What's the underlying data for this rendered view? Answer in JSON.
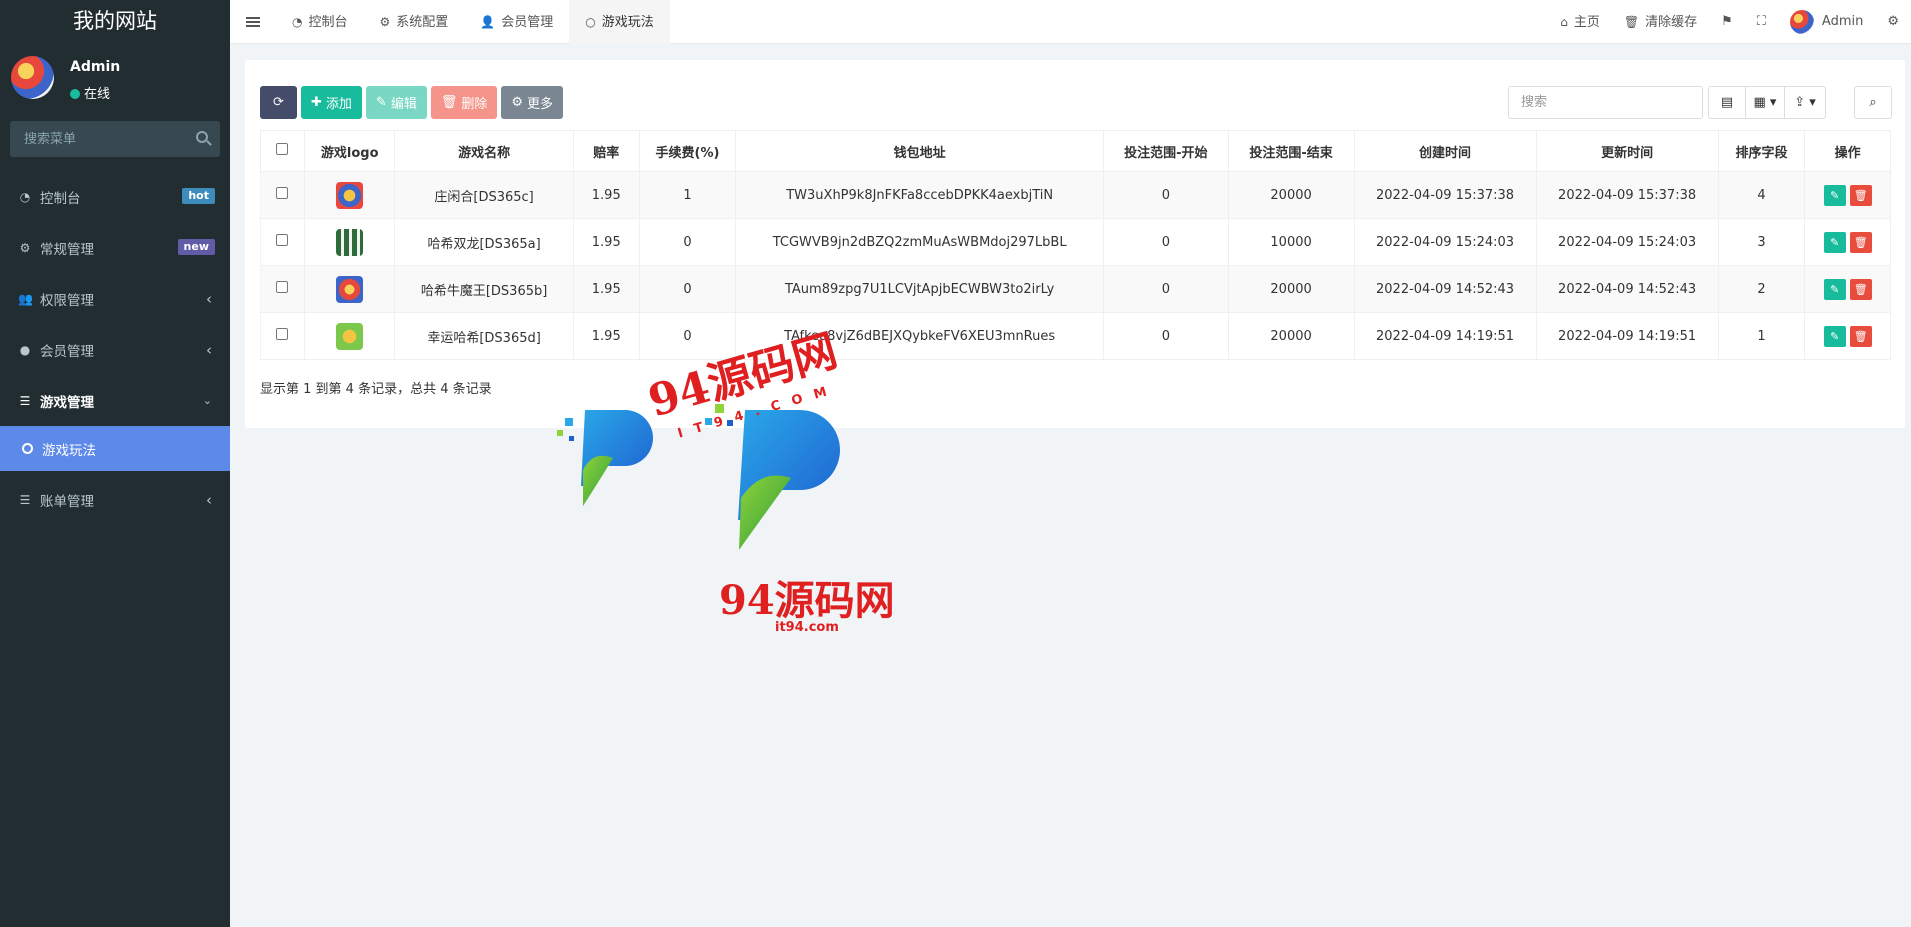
{
  "sidebar": {
    "brand": "我的网站",
    "user": {
      "name": "Admin",
      "status": "在线"
    },
    "search_placeholder": "搜索菜单",
    "items": [
      {
        "label": "控制台",
        "badge": "hot",
        "badge_color": "#3c8dbc"
      },
      {
        "label": "常规管理",
        "badge": "new",
        "badge_color": "#605ca8"
      },
      {
        "label": "权限管理"
      },
      {
        "label": "会员管理"
      },
      {
        "label": "游戏管理"
      },
      {
        "label": "账单管理"
      }
    ],
    "subitems": [
      {
        "label": "游戏玩法"
      }
    ]
  },
  "topbar": {
    "tabs": [
      {
        "label": "控制台"
      },
      {
        "label": "系统配置"
      },
      {
        "label": "会员管理"
      },
      {
        "label": "游戏玩法"
      }
    ],
    "home": "主页",
    "clear_cache": "清除缓存",
    "user": "Admin"
  },
  "toolbar": {
    "add": "添加",
    "edit": "编辑",
    "delete": "删除",
    "more": "更多",
    "search_placeholder": "搜索"
  },
  "table": {
    "headers": [
      "游戏logo",
      "游戏名称",
      "赔率",
      "手续费(%)",
      "钱包地址",
      "投注范围-开始",
      "投注范围-结束",
      "创建时间",
      "更新时间",
      "排序字段",
      "操作"
    ],
    "rows": [
      {
        "name": "庄闲合[DS365c]",
        "odds": "1.95",
        "fee": "1",
        "wallet": "TW3uXhP9k8JnFKFa8ccebDPKK4aexbjTiN",
        "start": "0",
        "end": "20000",
        "created": "2022-04-09 15:37:38",
        "updated": "2022-04-09 15:37:38",
        "sort": "4"
      },
      {
        "name": "哈希双龙[DS365a]",
        "odds": "1.95",
        "fee": "0",
        "wallet": "TCGWVB9jn2dBZQ2zmMuAsWBMdoj297LbBL",
        "start": "0",
        "end": "10000",
        "created": "2022-04-09 15:24:03",
        "updated": "2022-04-09 15:24:03",
        "sort": "3"
      },
      {
        "name": "哈希牛魔王[DS365b]",
        "odds": "1.95",
        "fee": "0",
        "wallet": "TAum89zpg7U1LCVjtApjbECWBW3to2irLy",
        "start": "0",
        "end": "20000",
        "created": "2022-04-09 14:52:43",
        "updated": "2022-04-09 14:52:43",
        "sort": "2"
      },
      {
        "name": "幸运哈希[DS365d]",
        "odds": "1.95",
        "fee": "0",
        "wallet": "TAfkeo8vjZ6dBEJXQybkeFV6XEU3mnRues",
        "start": "0",
        "end": "20000",
        "created": "2022-04-09 14:19:51",
        "updated": "2022-04-09 14:19:51",
        "sort": "1"
      }
    ]
  },
  "pager": {
    "info": "显示第 1 到第 4 条记录，总共 4 条记录"
  },
  "watermark": {
    "line1": "94源码网",
    "line2": "IT94.COM",
    "line3": "94源码网",
    "line4": "it94.com"
  },
  "colors": {
    "sidebar_bg": "#222d32",
    "active_menu": "#5d8ae8",
    "success": "#18bc9c",
    "danger": "#e74c3c"
  }
}
